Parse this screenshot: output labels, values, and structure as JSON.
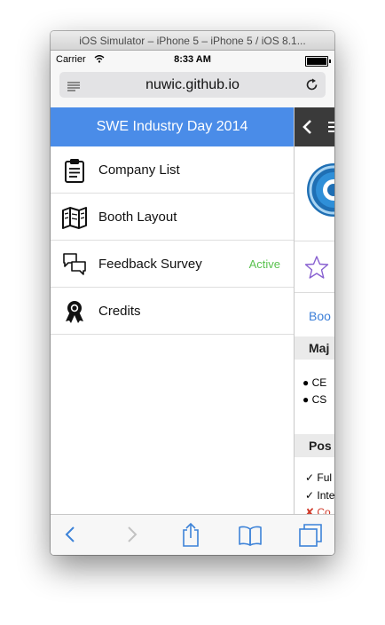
{
  "window": {
    "title": "iOS Simulator – iPhone 5 – iPhone 5 / iOS 8.1..."
  },
  "status_bar": {
    "carrier": "Carrier",
    "time": "8:33 AM"
  },
  "url_bar": {
    "url": "nuwic.github.io"
  },
  "nav": {
    "title": "SWE Industry Day 2014",
    "items": [
      {
        "label": "Company List",
        "icon": "clipboard-icon",
        "badge": ""
      },
      {
        "label": "Booth Layout",
        "icon": "map-icon",
        "badge": ""
      },
      {
        "label": "Feedback Survey",
        "icon": "chat-bubbles-icon",
        "badge": "Active"
      },
      {
        "label": "Credits",
        "icon": "award-ribbon-icon",
        "badge": ""
      }
    ]
  },
  "peek_content": {
    "link_text": "Boo",
    "section1_title": "Maj",
    "bullets": [
      "CE",
      "CS"
    ],
    "section2_title": "Pos",
    "checks": [
      "Ful",
      "Inte"
    ],
    "cross": "Co"
  },
  "colors": {
    "accent": "#4a8ce8",
    "active_badge": "#5ac24f",
    "toolbar_icon": "#3c82d8"
  },
  "toolbar": {
    "icons": [
      "back-icon",
      "forward-icon",
      "share-icon",
      "bookmarks-icon",
      "tabs-icon"
    ]
  }
}
